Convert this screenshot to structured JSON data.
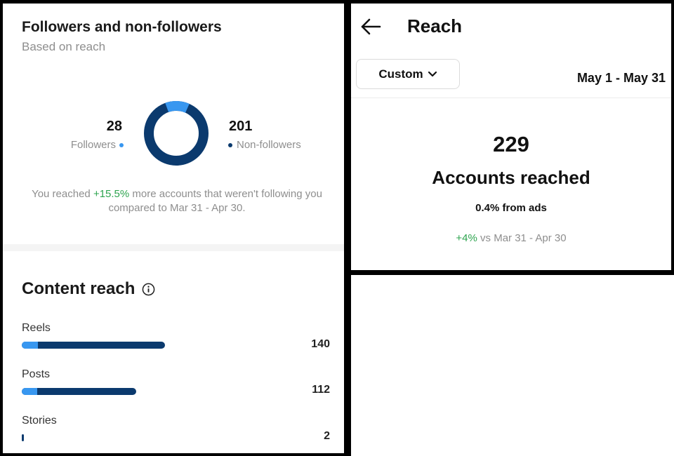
{
  "followers_card": {
    "title": "Followers and non-followers",
    "subtitle": "Based on reach",
    "followers_count": "28",
    "followers_label": "Followers",
    "non_followers_count": "201",
    "non_followers_label": "Non-followers",
    "followers_share": 0.122,
    "note_prefix": "You reached ",
    "note_change": "+15.5%",
    "note_suffix": " more accounts that weren't following you compared to Mar 31 - Apr 30."
  },
  "content_reach": {
    "title": "Content reach",
    "info_icon": "info-icon",
    "max_value": 140,
    "rows": [
      {
        "label": "Reels",
        "value": "140",
        "total": 140,
        "followers_part": 16
      },
      {
        "label": "Posts",
        "value": "112",
        "total": 112,
        "followers_part": 15
      },
      {
        "label": "Stories",
        "value": "2",
        "total": 2,
        "followers_part": 0
      }
    ]
  },
  "reach": {
    "title": "Reach",
    "back_icon": "back-arrow-icon",
    "range_button": "Custom",
    "range_icon": "chevron-down-icon",
    "date_range": "May 1 - May 31",
    "accounts_reached_value": "229",
    "accounts_reached_label": "Accounts reached",
    "from_ads": "0.4% from ads",
    "change": "+4%",
    "change_suffix": " vs Mar 31 - Apr 30"
  },
  "colors": {
    "followers": "#3897f0",
    "non_followers": "#0b3a6e",
    "positive": "#2ea44f",
    "muted": "#8e8e8e"
  }
}
